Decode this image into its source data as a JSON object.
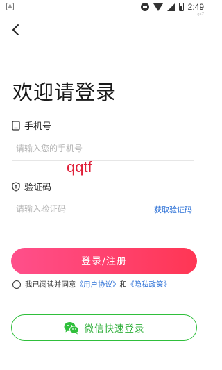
{
  "status_bar": {
    "left_badge": "A",
    "time": "2:49",
    "tiny_label": "gaZ"
  },
  "icons": {
    "back": "chevron-left-icon",
    "phone": "phone-icon",
    "code": "shield-icon",
    "wechat": "wechat-icon"
  },
  "title": "欢迎请登录",
  "phone": {
    "label": "手机号",
    "placeholder": "请输入您的手机号",
    "value": ""
  },
  "code": {
    "label": "验证码",
    "placeholder": "请输入验证码",
    "value": "",
    "get_code": "获取验证码"
  },
  "watermark": "qqtf",
  "login_button": "登录/注册",
  "agreement": {
    "prefix": "我已阅读并同意",
    "user_agreement": "《用户协议》",
    "and": "和",
    "privacy_policy": "《隐私政策》",
    "checked": false
  },
  "wechat_button": "微信快速登录",
  "colors": {
    "primary_gradient_start": "#ff4f8b",
    "primary_gradient_end": "#ff3654",
    "link": "#2a6fd6",
    "wechat_green": "#2fbf3b"
  }
}
